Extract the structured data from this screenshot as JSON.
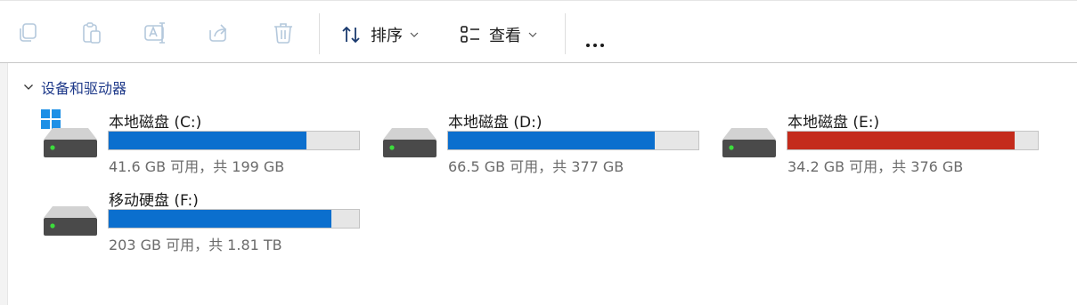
{
  "toolbar": {
    "sort_label": "排序",
    "view_label": "查看",
    "icons": [
      "copy-icon",
      "paste-icon",
      "rename-icon",
      "share-icon",
      "delete-icon",
      "sort-icon",
      "view-icon",
      "more-icon"
    ]
  },
  "group": {
    "title": "设备和驱动器"
  },
  "drives": [
    {
      "name": "本地磁盘 (C:)",
      "space": "41.6 GB 可用，共 199 GB",
      "used_fraction": 0.791,
      "bar_color": "#0b6fce",
      "system": true
    },
    {
      "name": "本地磁盘 (D:)",
      "space": "66.5 GB 可用，共 377 GB",
      "used_fraction": 0.824,
      "bar_color": "#0b6fce",
      "system": false
    },
    {
      "name": "本地磁盘 (E:)",
      "space": "34.2 GB 可用，共 376 GB",
      "used_fraction": 0.909,
      "bar_color": "#c42b1c",
      "system": false
    },
    {
      "name": "移动硬盘 (F:)",
      "space": "203 GB 可用，共 1.81 TB",
      "used_fraction": 0.89,
      "bar_color": "#0b6fce",
      "system": false
    }
  ],
  "colors": {
    "accent": "#0b6fce",
    "warning": "#c42b1c",
    "bar_track": "#e6e6e6",
    "header_text": "#1f3a8a"
  }
}
